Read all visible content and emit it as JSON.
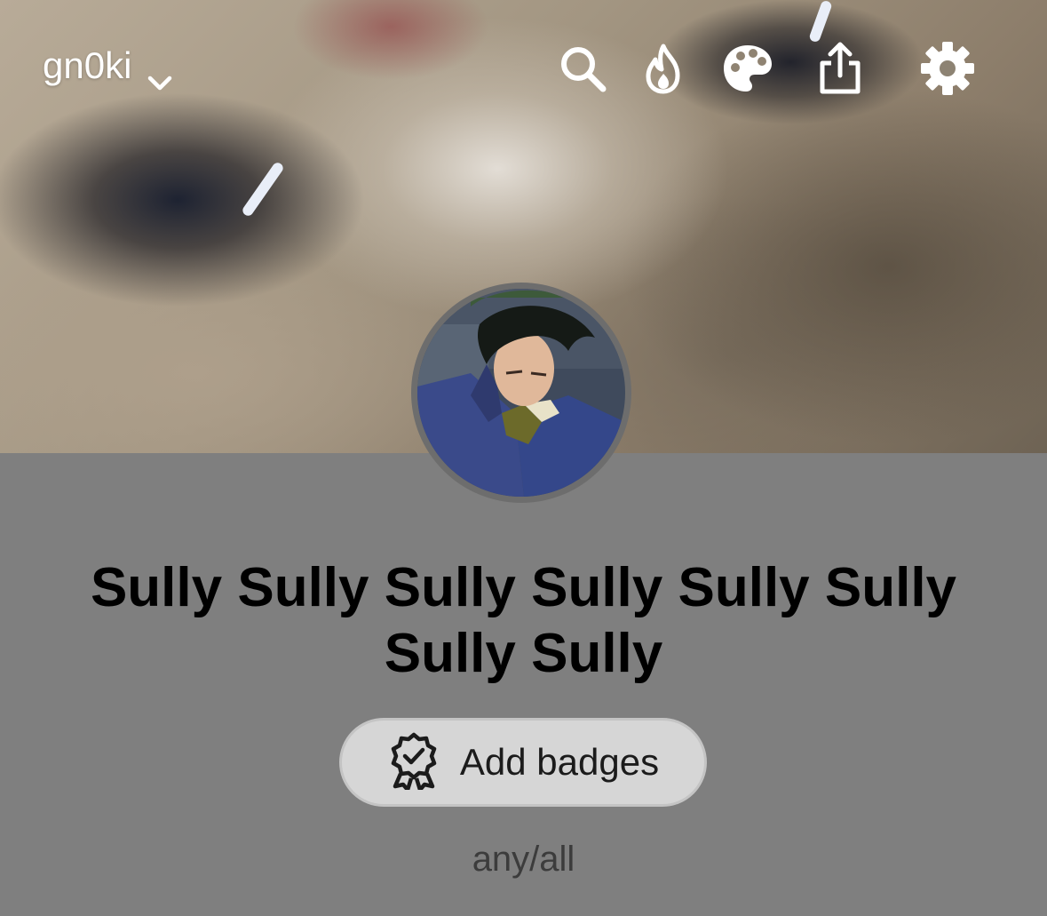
{
  "header": {
    "account_name": "gn0ki",
    "icons": [
      "search-icon",
      "flame-icon",
      "palette-icon",
      "share-icon",
      "gear-icon"
    ]
  },
  "profile": {
    "display_name": "Sully Sully Sully Sully Sully Sully Sully Sully",
    "add_badges_label": "Add badges",
    "bio": "any/all"
  },
  "colors": {
    "background": "#7f7f7f",
    "button_bg": "#d6d6d6",
    "text_primary": "#000000",
    "text_secondary": "#3c3c3c",
    "icon_white": "#ffffff"
  }
}
